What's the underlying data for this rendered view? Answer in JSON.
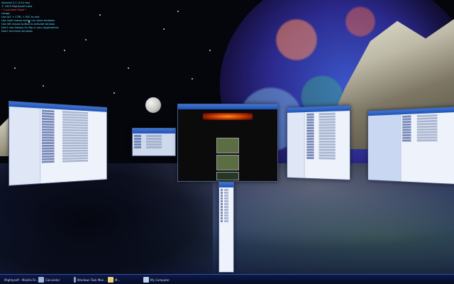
{
  "hud": {
    "lines": [
      {
        "text": "Asteroid 3.1 (13.0 fps)",
        "red": false
      },
      {
        "text": "© 2005 Mightysoft Labs",
        "red": false
      },
      {
        "text": "* Controlled Mode *",
        "red": true
      },
      {
        "text": "Usage:",
        "red": false
      },
      {
        "text": "  Use ALT + CTRL + ESC to exit",
        "red": false
      },
      {
        "text": "  Use right mouse button to move windows",
        "red": false
      },
      {
        "text": "  Use left mouse button to activate window",
        "red": false
      },
      {
        "text": "  Don't use Always-On-Top in your applications",
        "red": false
      },
      {
        "text": "  Don't minimize windows",
        "red": false
      }
    ]
  },
  "taskbar": {
    "items": [
      {
        "label": "Mightysoft - Mozilla Fir...",
        "icon": "firefox-icon",
        "color": "#e8792c"
      },
      {
        "label": "Calculator",
        "icon": "calculator-icon",
        "color": "#9fb3d6"
      },
      {
        "label": "Windows Task Man...",
        "icon": "task-manager-icon",
        "color": "#8aa0c8"
      },
      {
        "label": "M...",
        "icon": "folder-icon",
        "color": "#e9d07a"
      },
      {
        "label": "My Computer",
        "icon": "computer-icon",
        "color": "#bcd2ee"
      }
    ]
  },
  "colors": {
    "taskbar": "#0a1438",
    "hud_text": "#5fe0ff",
    "hud_alert": "#ff5050",
    "titlebar": "#2c62c6"
  }
}
